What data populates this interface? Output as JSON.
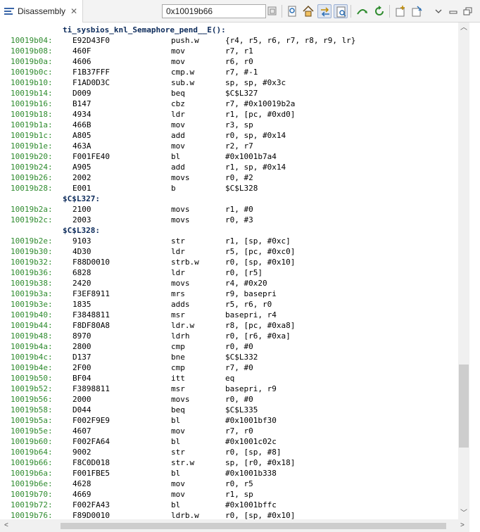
{
  "tab": {
    "label": "Disassembly",
    "close": "✕"
  },
  "address_field": {
    "value": "0x10019b66"
  },
  "toolbar_icons": [
    "go-to-address-icon",
    "home-icon",
    "show-source-toggle-icon",
    "show-symbols-toggle-icon",
    "step-over-icon",
    "refresh-icon",
    "new-view-icon",
    "pin-view-icon",
    "view-menu-icon",
    "minimize-icon",
    "maximize-icon"
  ],
  "function_label": "ti_sysbios_knl_Semaphore_pend__E():",
  "rows": [
    {
      "kind": "label",
      "text": "ti_sysbios_knl_Semaphore_pend__E():"
    },
    {
      "kind": "ins",
      "addr": "10019b04:",
      "op": "E92D43F0",
      "mn": "push.w",
      "args": "{r4, r5, r6, r7, r8, r9, lr}"
    },
    {
      "kind": "ins",
      "addr": "10019b08:",
      "op": "460F",
      "mn": "mov",
      "args": "r7, r1"
    },
    {
      "kind": "ins",
      "addr": "10019b0a:",
      "op": "4606",
      "mn": "mov",
      "args": "r6, r0"
    },
    {
      "kind": "ins",
      "addr": "10019b0c:",
      "op": "F1B37FFF",
      "mn": "cmp.w",
      "args": "r7, #-1"
    },
    {
      "kind": "ins",
      "addr": "10019b10:",
      "op": "F1AD0D3C",
      "mn": "sub.w",
      "args": "sp, sp, #0x3c"
    },
    {
      "kind": "ins",
      "addr": "10019b14:",
      "op": "D009",
      "mn": "beq",
      "args": "$C$L327"
    },
    {
      "kind": "ins",
      "addr": "10019b16:",
      "op": "B147",
      "mn": "cbz",
      "args": "r7, #0x10019b2a"
    },
    {
      "kind": "ins",
      "addr": "10019b18:",
      "op": "4934",
      "mn": "ldr",
      "args": "r1, [pc, #0xd0]"
    },
    {
      "kind": "ins",
      "addr": "10019b1a:",
      "op": "466B",
      "mn": "mov",
      "args": "r3, sp"
    },
    {
      "kind": "ins",
      "addr": "10019b1c:",
      "op": "A805",
      "mn": "add",
      "args": "r0, sp, #0x14"
    },
    {
      "kind": "ins",
      "addr": "10019b1e:",
      "op": "463A",
      "mn": "mov",
      "args": "r2, r7"
    },
    {
      "kind": "ins",
      "addr": "10019b20:",
      "op": "F001FE40",
      "mn": "bl",
      "args": "#0x1001b7a4"
    },
    {
      "kind": "ins",
      "addr": "10019b24:",
      "op": "A905",
      "mn": "add",
      "args": "r1, sp, #0x14"
    },
    {
      "kind": "ins",
      "addr": "10019b26:",
      "op": "2002",
      "mn": "movs",
      "args": "r0, #2"
    },
    {
      "kind": "ins",
      "addr": "10019b28:",
      "op": "E001",
      "mn": "b",
      "args": "$C$L328"
    },
    {
      "kind": "label",
      "text": "$C$L327:"
    },
    {
      "kind": "ins",
      "addr": "10019b2a:",
      "op": "2100",
      "mn": "movs",
      "args": "r1, #0"
    },
    {
      "kind": "ins",
      "addr": "10019b2c:",
      "op": "2003",
      "mn": "movs",
      "args": "r0, #3"
    },
    {
      "kind": "label",
      "text": "$C$L328:"
    },
    {
      "kind": "ins",
      "addr": "10019b2e:",
      "op": "9103",
      "mn": "str",
      "args": "r1, [sp, #0xc]"
    },
    {
      "kind": "ins",
      "addr": "10019b30:",
      "op": "4D30",
      "mn": "ldr",
      "args": "r5, [pc, #0xc0]"
    },
    {
      "kind": "ins",
      "addr": "10019b32:",
      "op": "F88D0010",
      "mn": "strb.w",
      "args": "r0, [sp, #0x10]"
    },
    {
      "kind": "ins",
      "addr": "10019b36:",
      "op": "6828",
      "mn": "ldr",
      "args": "r0, [r5]"
    },
    {
      "kind": "ins",
      "addr": "10019b38:",
      "op": "2420",
      "mn": "movs",
      "args": "r4, #0x20"
    },
    {
      "kind": "ins",
      "addr": "10019b3a:",
      "op": "F3EF8911",
      "mn": "mrs",
      "args": "r9, basepri"
    },
    {
      "kind": "ins",
      "addr": "10019b3e:",
      "op": "1835",
      "mn": "adds",
      "args": "r5, r6, r0"
    },
    {
      "kind": "ins",
      "addr": "10019b40:",
      "op": "F3848811",
      "mn": "msr",
      "args": "basepri, r4"
    },
    {
      "kind": "ins",
      "addr": "10019b44:",
      "op": "F8DF80A8",
      "mn": "ldr.w",
      "args": "r8, [pc, #0xa8]"
    },
    {
      "kind": "ins",
      "addr": "10019b48:",
      "op": "8970",
      "mn": "ldrh",
      "args": "r0, [r6, #0xa]"
    },
    {
      "kind": "ins",
      "addr": "10019b4a:",
      "op": "2800",
      "mn": "cmp",
      "args": "r0, #0"
    },
    {
      "kind": "ins",
      "addr": "10019b4c:",
      "op": "D137",
      "mn": "bne",
      "args": "$C$L332"
    },
    {
      "kind": "ins",
      "addr": "10019b4e:",
      "op": "2F00",
      "mn": "cmp",
      "args": "r7, #0"
    },
    {
      "kind": "ins",
      "addr": "10019b50:",
      "op": "BF04",
      "mn": "itt",
      "args": "eq"
    },
    {
      "kind": "ins",
      "addr": "10019b52:",
      "op": "F3898811",
      "mn": "msr",
      "args": "basepri, r9"
    },
    {
      "kind": "ins",
      "addr": "10019b56:",
      "op": "2000",
      "mn": "movs",
      "args": "r0, #0"
    },
    {
      "kind": "ins",
      "addr": "10019b58:",
      "op": "D044",
      "mn": "beq",
      "args": "$C$L335"
    },
    {
      "kind": "ins",
      "addr": "10019b5a:",
      "op": "F002F9E9",
      "mn": "bl",
      "args": "#0x1001bf30"
    },
    {
      "kind": "ins",
      "addr": "10019b5e:",
      "op": "4607",
      "mn": "mov",
      "args": "r7, r0"
    },
    {
      "kind": "ins",
      "addr": "10019b60:",
      "op": "F002FA64",
      "mn": "bl",
      "args": "#0x1001c02c"
    },
    {
      "kind": "ins",
      "addr": "10019b64:",
      "op": "9002",
      "mn": "str",
      "args": "r0, [sp, #8]"
    },
    {
      "kind": "ins",
      "addr": "10019b66:",
      "op": "F8C0D018",
      "mn": "str.w",
      "args": "sp, [r0, #0x18]"
    },
    {
      "kind": "ins",
      "addr": "10019b6a:",
      "op": "F001FBE5",
      "mn": "bl",
      "args": "#0x1001b338"
    },
    {
      "kind": "ins",
      "addr": "10019b6e:",
      "op": "4628",
      "mn": "mov",
      "args": "r0, r5"
    },
    {
      "kind": "ins",
      "addr": "10019b70:",
      "op": "4669",
      "mn": "mov",
      "args": "r1, sp"
    },
    {
      "kind": "ins",
      "addr": "10019b72:",
      "op": "F002FA43",
      "mn": "bl",
      "args": "#0x1001bffc"
    },
    {
      "kind": "ins",
      "addr": "10019b76:",
      "op": "F89D0010",
      "mn": "ldrb.w",
      "args": "r0, [sp, #0x10]"
    }
  ]
}
